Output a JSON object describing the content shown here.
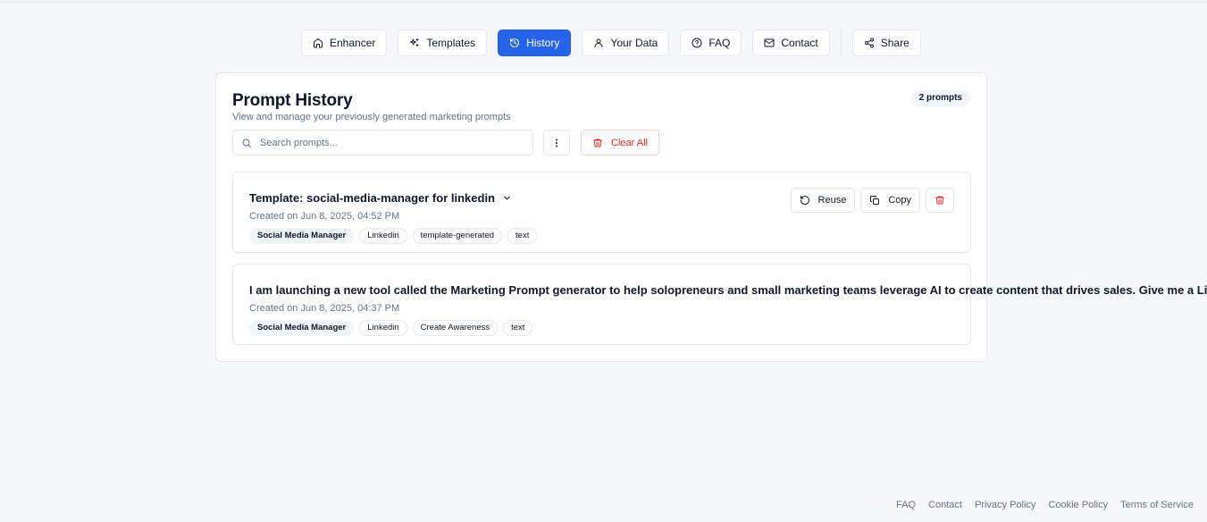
{
  "nav": {
    "items": [
      {
        "label": "Enhancer",
        "icon": "home-icon",
        "active": false
      },
      {
        "label": "Templates",
        "icon": "sparkles-icon",
        "active": false
      },
      {
        "label": "History",
        "icon": "history-icon",
        "active": true
      },
      {
        "label": "Your Data",
        "icon": "user-icon",
        "active": false
      },
      {
        "label": "FAQ",
        "icon": "help-circle-icon",
        "active": false
      },
      {
        "label": "Contact",
        "icon": "mail-icon",
        "active": false
      }
    ],
    "share_label": "Share"
  },
  "history": {
    "title": "Prompt History",
    "subtitle": "View and manage your previously generated marketing prompts",
    "count_badge": "2 prompts",
    "search_placeholder": "Search prompts...",
    "clear_all_label": "Clear All",
    "items": [
      {
        "title": "Template: social-media-manager for linkedin",
        "date": "Created on Jun 8, 2025, 04:52 PM",
        "tags": [
          "Social Media Manager",
          "Linkedin",
          "template-generated",
          "text"
        ],
        "reuse_label": "Reuse",
        "copy_label": "Copy"
      },
      {
        "title": "I am launching a new tool called the Marketing Prompt generator to help solopreneurs and small marketing teams leverage AI to create content that drives sales. Give me a Lin",
        "date": "Created on Jun 8, 2025, 04:37 PM",
        "tags": [
          "Social Media Manager",
          "Linkedin",
          "Create Awareness",
          "text"
        ]
      }
    ]
  },
  "footer": {
    "links": [
      "FAQ",
      "Contact",
      "Privacy Policy",
      "Cookie Policy",
      "Terms of Service"
    ]
  },
  "colors": {
    "accent": "#2563eb",
    "danger": "#dc2626",
    "muted_text": "#64748b",
    "background": "#f5f7fa"
  }
}
